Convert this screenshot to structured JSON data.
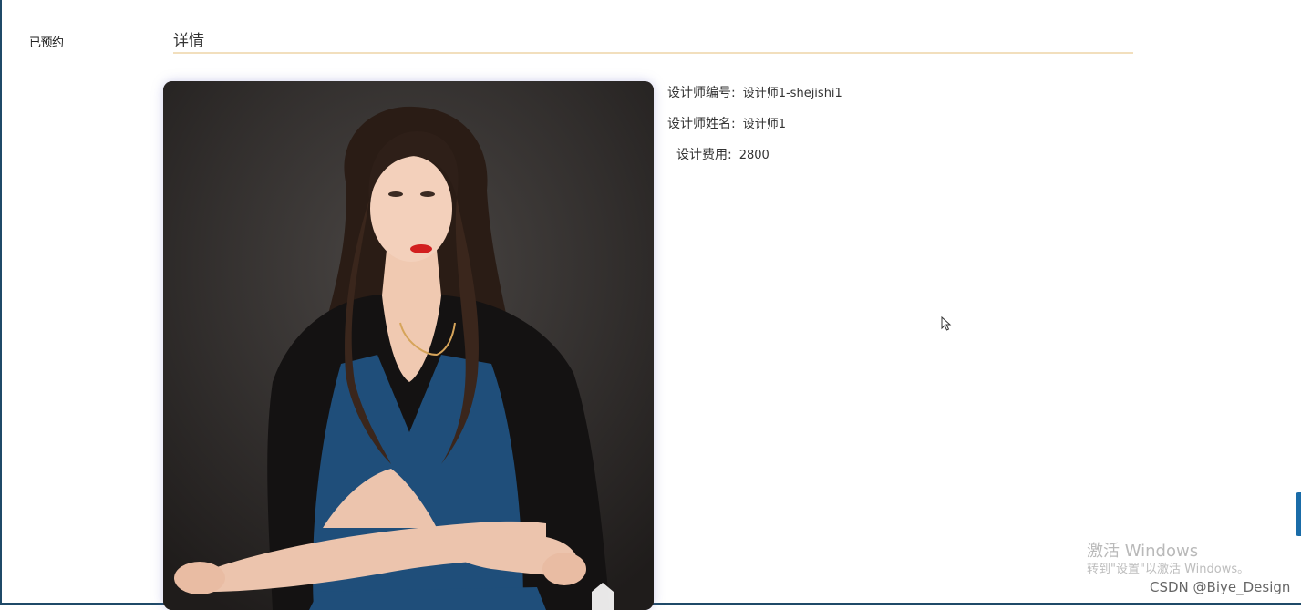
{
  "sidebar": {
    "label": "已预约"
  },
  "section": {
    "title": "详情"
  },
  "photo": {
    "alt": "设计师照片"
  },
  "details": [
    {
      "label": "设计师编号:",
      "value": "设计师1-shejishi1"
    },
    {
      "label": "设计师姓名:",
      "value": "设计师1"
    },
    {
      "label": "设计费用:",
      "value": "2800"
    }
  ],
  "watermark": {
    "line1": "激活 Windows",
    "line2": "转到\"设置\"以激活 Windows。"
  },
  "credit": "CSDN @Biye_Design",
  "colors": {
    "divider": "#f2dfbd",
    "photo_background": "#2d2a29",
    "dress": "#1f4e7a"
  }
}
